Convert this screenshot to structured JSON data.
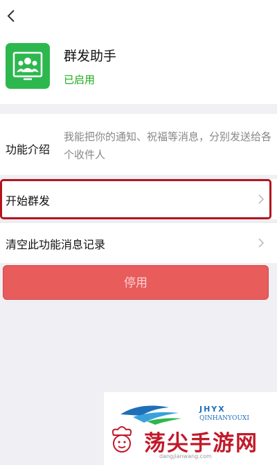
{
  "header": {
    "back_icon": "chevron-left-icon"
  },
  "app": {
    "icon": "group-users-icon",
    "icon_color": "#2db84e",
    "name": "群发助手",
    "status": "已启用",
    "status_color": "#1aad19"
  },
  "intro": {
    "label": "功能介绍",
    "text": "我能把你的通知、祝福等消息，分别发送给各个收件人"
  },
  "rows": [
    {
      "label": "开始群发",
      "icon": "chevron-right-icon",
      "highlighted": true
    },
    {
      "label": "清空此功能消息记录",
      "icon": "chevron-right-icon"
    }
  ],
  "stop_button": {
    "label": "停用",
    "color": "#e85c5c"
  },
  "watermark": {
    "brand_code": "JHYX",
    "brand_en": "QINHANYOUXI",
    "brand_cn": "荡尖手游网",
    "url": "dangjianwang.com",
    "accent_color": "#c21a2a"
  }
}
